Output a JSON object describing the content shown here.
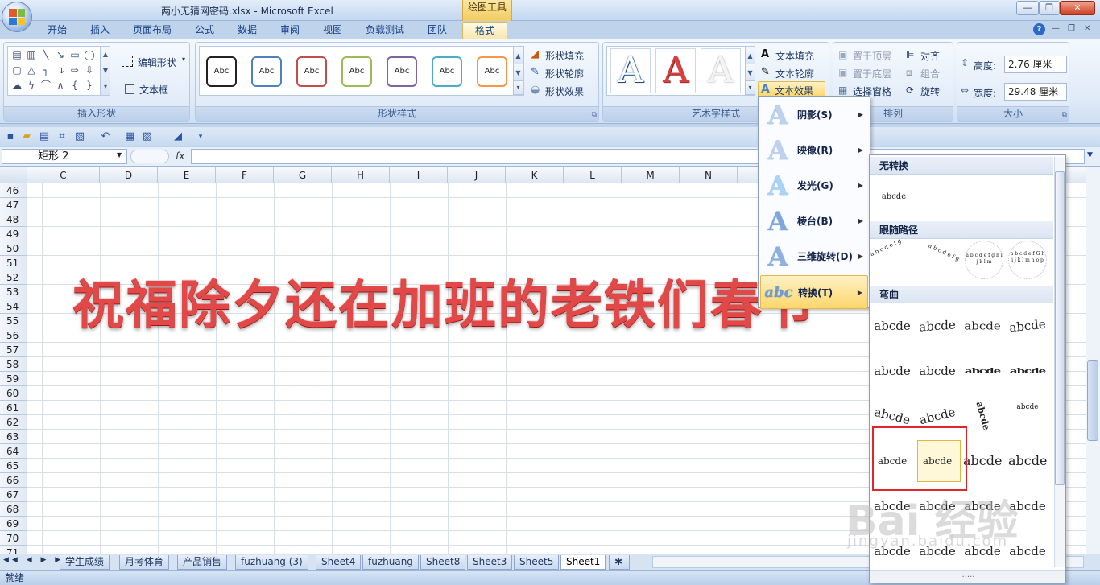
{
  "window": {
    "title": "两小无猜网密码.xlsx - Microsoft Excel",
    "context_tab_title": "绘图工具"
  },
  "tabs": [
    "开始",
    "插入",
    "页面布局",
    "公式",
    "数据",
    "审阅",
    "视图",
    "负载测试",
    "团队",
    "格式"
  ],
  "ribbon": {
    "groups": {
      "insert_shapes": "插入形状",
      "shape_styles": "形状样式",
      "wordart": "艺术字样式",
      "arrange": "排列",
      "size": "大小"
    },
    "edit_shape": "编辑形状",
    "text_box": "文本框",
    "style_sample": "Abc",
    "shape_fill": "形状填充",
    "shape_outline": "形状轮廓",
    "shape_effects": "形状效果",
    "text_fill": "文本填充",
    "text_outline": "文本轮廓",
    "text_effects": "文本效果",
    "bring_front": "置于顶层",
    "send_back": "置于底层",
    "selection_pane": "选择窗格",
    "align": "对齐",
    "group": "组合",
    "rotate": "旋转",
    "height_label": "高度:",
    "height_value": "2.76 厘米",
    "width_label": "宽度:",
    "width_value": "29.48 厘米",
    "wordart_letter": "A"
  },
  "formula_bar": {
    "name_box": "矩形 2",
    "fx": "fx"
  },
  "columns": [
    "C",
    "D",
    "E",
    "F",
    "G",
    "H",
    "I",
    "J",
    "K",
    "L",
    "M",
    "N"
  ],
  "rows": [
    "46",
    "47",
    "48",
    "49",
    "50",
    "51",
    "52",
    "53",
    "54",
    "55",
    "56",
    "57",
    "58",
    "59",
    "60",
    "61",
    "62",
    "63",
    "64",
    "65",
    "66",
    "67",
    "68",
    "69",
    "70",
    "71"
  ],
  "wordart_text": "祝福除夕还在加班的老铁们春节",
  "sheets": [
    "学生成绩",
    "月考体育",
    "产品销售",
    "fuzhuang (3)",
    "Sheet4",
    "fuzhuang",
    "Sheet8",
    "Sheet3",
    "Sheet5",
    "Sheet1"
  ],
  "status": "就绪",
  "effects_menu": [
    {
      "label": "阴影(S)",
      "icon": "shadow-icon"
    },
    {
      "label": "映像(R)",
      "icon": "reflection-icon"
    },
    {
      "label": "发光(G)",
      "icon": "glow-icon"
    },
    {
      "label": "棱台(B)",
      "icon": "bevel-icon"
    },
    {
      "label": "三维旋转(D)",
      "icon": "3d-rotation-icon"
    },
    {
      "label": "转换(T)",
      "icon": "transform-icon"
    }
  ],
  "transform_panel": {
    "no_transform": "无转换",
    "follow_path": "跟随路径",
    "warp": "弯曲",
    "sample": "abcde",
    "path_sample_1": "a b c d e f g",
    "path_sample_2": "a b c d e f g",
    "path_sample_3": "a b c d e f g h i j k l m",
    "path_sample_4": "a b c d e f G h i j k l m n o p",
    "grip": "....."
  },
  "watermark": {
    "main": "Bai 经验",
    "sub": "jingyan.baidu.com"
  },
  "colors": {
    "accent_tab": "#f8e7ae",
    "wordart_red": "#e14848",
    "highlight_box": "#e0262b"
  }
}
